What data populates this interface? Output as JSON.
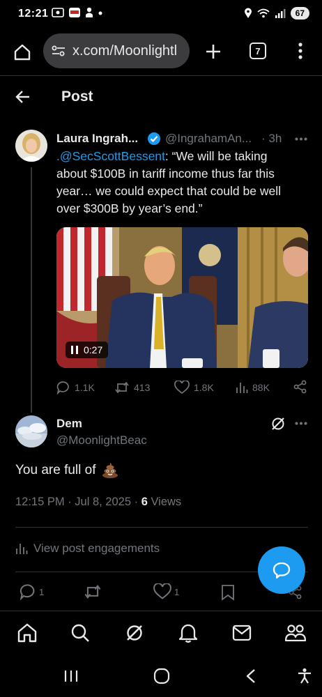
{
  "status_bar": {
    "time": "12:21",
    "battery": "67"
  },
  "browser": {
    "url": "x.com/Moonlightl",
    "tab_count": "7"
  },
  "header": {
    "title": "Post"
  },
  "parent_tweet": {
    "name": "Laura Ingrah...",
    "handle": "@IngrahamAn...",
    "time": "· 3h",
    "mention": ".@SecScottBessent",
    "text": ": “We will be taking about $100B in tariff income thus far this year… we could expect that could be well over $300B by year’s end.”",
    "video_time": "0:27",
    "replies": "1.1K",
    "reposts": "413",
    "likes": "1.8K",
    "views": "88K"
  },
  "reply_tweet": {
    "name": "Dem",
    "handle": "@MoonlightBeac",
    "text": "You are full of",
    "timestamp": "12:15 PM · Jul 8, 2025 · ",
    "view_count": "6",
    "views_label": " Views",
    "engagements_label": "View post engagements",
    "replies": "1",
    "likes": "1"
  },
  "colors": {
    "background": "#000000",
    "accent": "#1d9bf0",
    "text_primary": "#e7e9ea",
    "text_secondary": "#71767b",
    "divider": "#2f3336"
  },
  "icons": {
    "status": [
      "screenshot-icon",
      "news-app-icon",
      "notification-person-icon",
      "dot-icon",
      "location-icon",
      "wifi-icon",
      "signal-icon",
      "battery-icon"
    ],
    "browser": [
      "home-icon",
      "tune-icon",
      "plus-icon",
      "tabs-icon",
      "menu-dots-icon"
    ],
    "nav": [
      "home-icon",
      "search-icon",
      "grok-icon",
      "notifications-icon",
      "messages-icon",
      "communities-icon"
    ],
    "system": [
      "recents-icon",
      "home-circle-icon",
      "back-icon",
      "accessibility-icon"
    ]
  }
}
